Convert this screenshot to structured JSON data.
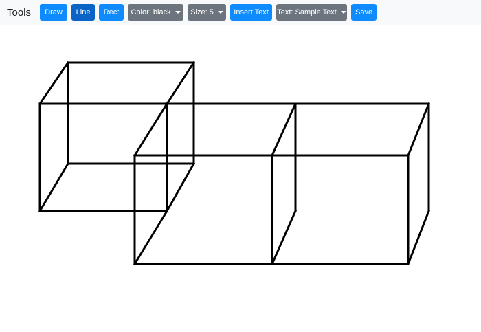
{
  "toolbar": {
    "brand": "Tools",
    "draw_label": "Draw",
    "line_label": "Line",
    "rect_label": "Rect",
    "color_label": "Color: black",
    "size_label": "Size: 5",
    "insert_text_label": "Insert Text",
    "text_label": "Text: Sample Text",
    "save_label": "Save"
  },
  "colors": {
    "primary": "#0d8bff",
    "active": "#0a64c8",
    "secondary": "#6c757d",
    "stroke": "#000000"
  }
}
